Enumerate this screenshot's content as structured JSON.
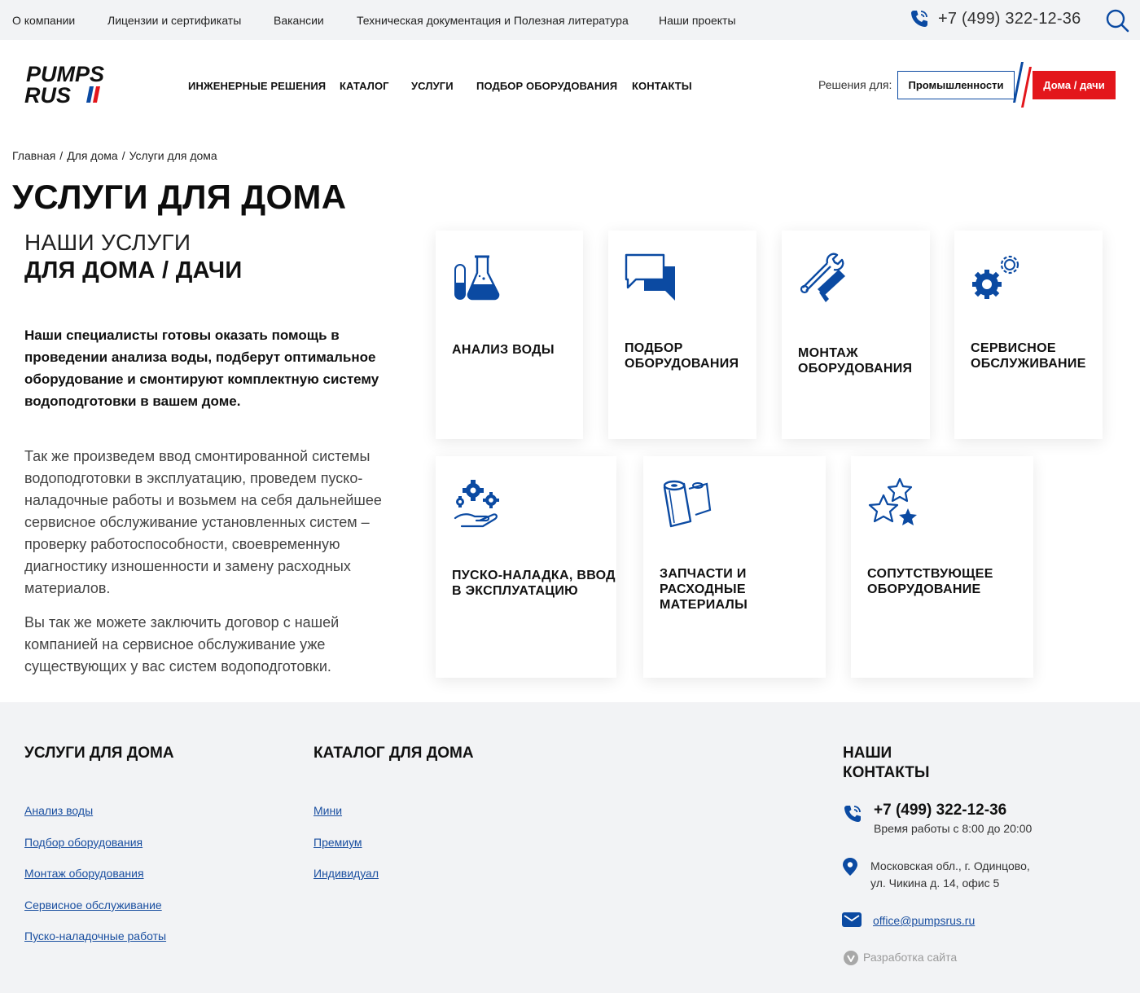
{
  "topbar": {
    "links": [
      "О компании",
      "Лицензии и сертификаты",
      "Вакансии",
      "Техническая документация и Полезная литература",
      "Наши проекты"
    ],
    "phone": "+7 (499) 322-12-36",
    "phone_icon": "phone-icon",
    "search_icon": "search-icon"
  },
  "header": {
    "logo_line1": "PUMPS",
    "logo_line2": "RUS",
    "nav": [
      "ИНЖЕНЕРНЫЕ РЕШЕНИЯ",
      "КАТАЛОГ",
      "УСЛУГИ",
      "ПОДБОР ОБОРУДОВАНИЯ",
      "КОНТАКТЫ"
    ],
    "solutions_label": "Решения для:",
    "btn_industry": "Промышленности",
    "btn_home": "Дома / дачи"
  },
  "breadcrumbs": [
    "Главная",
    "Для дома",
    "Услуги для дома"
  ],
  "page_title": "УСЛУГИ ДЛЯ ДОМА",
  "intro": {
    "subtitle1": "НАШИ УСЛУГИ",
    "subtitle2": "ДЛЯ ДОМА / ДАЧИ",
    "lead": "Наши специалисты готовы оказать помощь в проведении анализа воды, подберут оптимальное оборудование и смонтируют комплектную систему водоподготовки в вашем доме.",
    "paragraph1": "Так же произведем ввод смонтированной системы водоподготовки в эксплуатацию, проведем пуско-наладочные работы и возьмем на себя дальнейшее сервисное обслуживание установленных систем – проверку работоспособности, своевременную диагностику изношенности и замену расходных материалов.",
    "paragraph2": "Вы так же можете заключить договор с нашей компанией на сервисное обслуживание уже существующих у вас систем водоподготовки."
  },
  "services": [
    {
      "label": "Анализ воды",
      "icon": "flask-icon"
    },
    {
      "label": "Подбор оборудования",
      "icon": "chat-icon"
    },
    {
      "label": "Монтаж оборудования",
      "icon": "wrench-icon"
    },
    {
      "label": "Сервисное обслуживание",
      "icon": "gears-icon"
    },
    {
      "label": "Пуско-наладка, ввод в эксплуатацию",
      "icon": "hand-gears-icon"
    },
    {
      "label": "Запчасти и расходные материалы",
      "icon": "filter-icon"
    },
    {
      "label": "Сопутствующее оборудование",
      "icon": "stars-icon"
    }
  ],
  "footer": {
    "services_title": "Услуги для дома",
    "services_links": [
      "Анализ воды",
      "Подбор оборудования",
      "Монтаж оборудования",
      "Сервисное обслуживание",
      "Пуско-наладочные работы"
    ],
    "catalog_title": "Каталог для дома",
    "catalog_links": [
      "Мини",
      "Премиум",
      "Индивидуал"
    ],
    "contacts_title": "Наши контакты",
    "phone": "+7 (499) 322-12-36",
    "hours": "Время работы с 8:00 до 20:00",
    "address_line1": "Московская обл., г. Одинцово,",
    "address_line2": "ул. Чикина д. 14, офис 5",
    "email": "office@pumpsrus.ru",
    "dev": "Разработка сайта"
  },
  "colors": {
    "accent_blue": "#0b4aa2",
    "accent_red": "#e3161b",
    "footer_bg": "#f2f3f5"
  }
}
